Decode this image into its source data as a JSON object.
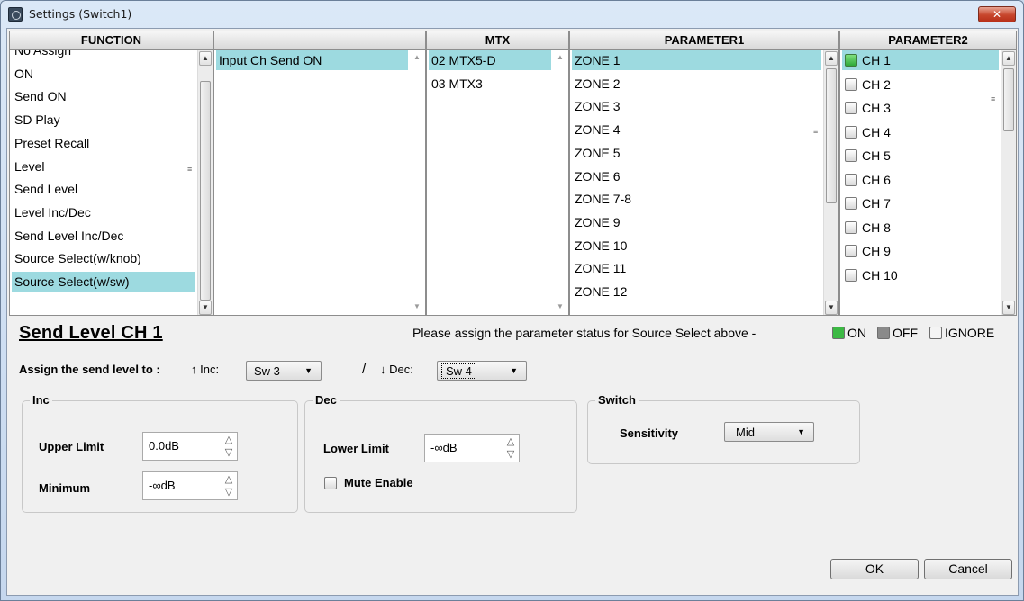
{
  "window": {
    "title": "Settings (Switch1)",
    "close_glyph": "✕"
  },
  "headers": {
    "function": "FUNCTION",
    "col2": "",
    "mtx": "MTX",
    "param1": "PARAMETER1",
    "param2": "PARAMETER2"
  },
  "function_list": {
    "items": [
      "No Assign",
      "ON",
      "Send ON",
      "SD Play",
      "Preset Recall",
      "Level",
      "Send Level",
      "Level Inc/Dec",
      "Send Level Inc/Dec",
      "Source Select(w/knob)",
      "Source Select(w/sw)"
    ],
    "selected": "Source Select(w/sw)"
  },
  "col2_list": {
    "items": [
      "Input Ch Send ON"
    ],
    "selected": "Input Ch Send ON"
  },
  "mtx_list": {
    "items": [
      "02 MTX5-D",
      "03 MTX3"
    ],
    "selected": "02 MTX5-D"
  },
  "param1_list": {
    "items": [
      "ZONE 1",
      "ZONE 2",
      "ZONE 3",
      "ZONE 4",
      "ZONE 5",
      "ZONE 6",
      "ZONE 7-8",
      "ZONE 9",
      "ZONE 10",
      "ZONE 11",
      "ZONE 12"
    ],
    "selected": "ZONE 1"
  },
  "param2_list": {
    "items": [
      {
        "label": "CH 1",
        "state": "on"
      },
      {
        "label": "CH 2",
        "state": "ignore"
      },
      {
        "label": "CH 3",
        "state": "ignore"
      },
      {
        "label": "CH 4",
        "state": "ignore"
      },
      {
        "label": "CH 5",
        "state": "ignore"
      },
      {
        "label": "CH 6",
        "state": "ignore"
      },
      {
        "label": "CH 7",
        "state": "ignore"
      },
      {
        "label": "CH 8",
        "state": "ignore"
      },
      {
        "label": "CH 9",
        "state": "ignore"
      },
      {
        "label": "CH 10",
        "state": "ignore"
      }
    ],
    "selected": "CH 1"
  },
  "section_title": "Send Level CH 1",
  "legend": {
    "text": "Please assign the parameter status for Source Select above -",
    "on": "ON",
    "off": "OFF",
    "ignore": "IGNORE",
    "colors": {
      "on": "#3cb944",
      "off": "#8a8a8a",
      "ignore": "#f4f4f4"
    }
  },
  "assign": {
    "label": "Assign the send level to :",
    "inc_label": "↑ Inc:",
    "inc_value": "Sw 3",
    "separator": "/",
    "dec_label": "↓ Dec:",
    "dec_value": "Sw 4"
  },
  "inc_group": {
    "title": "Inc",
    "upper_limit_label": "Upper Limit",
    "upper_limit_value": "0.0dB",
    "minimum_label": "Minimum",
    "minimum_value": "-∞dB"
  },
  "dec_group": {
    "title": "Dec",
    "lower_limit_label": "Lower Limit",
    "lower_limit_value": "-∞dB",
    "mute_enable_label": "Mute Enable"
  },
  "switch_group": {
    "title": "Switch",
    "sensitivity_label": "Sensitivity",
    "sensitivity_value": "Mid"
  },
  "buttons": {
    "ok": "OK",
    "cancel": "Cancel"
  },
  "glyphs": {
    "up": "▲",
    "down": "▼",
    "spin_up": "△",
    "spin_down": "▽",
    "grip": "≡"
  }
}
